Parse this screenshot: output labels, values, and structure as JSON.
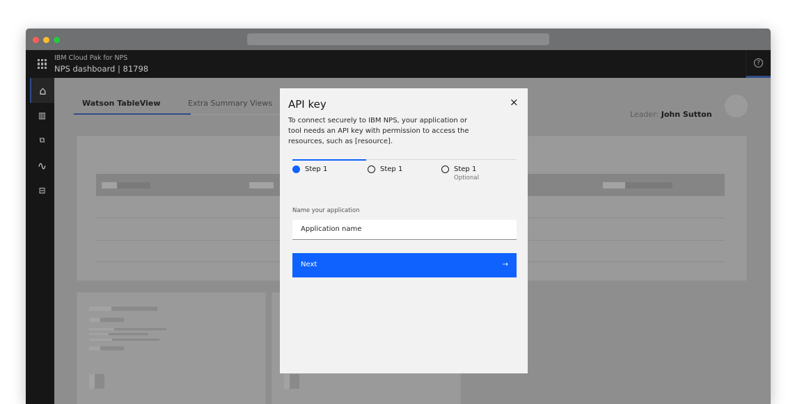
{
  "header": {
    "product": "IBM Cloud Pak for NPS",
    "title": "NPS dashboard | 81798"
  },
  "tabs": [
    {
      "label": "Watson TableView",
      "active": true
    },
    {
      "label": "Extra Summary Views",
      "active": false
    }
  ],
  "leader": {
    "label": "Leader:",
    "name": "John Sutton"
  },
  "sidebar": {
    "items": [
      "home-icon",
      "columns-icon",
      "diagram-icon",
      "activity-icon",
      "toolbox-icon"
    ]
  },
  "modal": {
    "title": "API key",
    "description": "To connect securely to IBM NPS, your application or tool needs an API key with permission to access the resources, such as [resource].",
    "steps": [
      {
        "label": "Step 1",
        "state": "current"
      },
      {
        "label": "Step 1",
        "state": "incomplete"
      },
      {
        "label": "Step 1",
        "state": "incomplete",
        "sublabel": "Optional"
      }
    ],
    "field_label": "Name your application",
    "field_value": "Application name",
    "next_label": "Next"
  },
  "colors": {
    "accent": "#0f62fe",
    "header": "#161616",
    "modal_bg": "#f2f2f2"
  }
}
